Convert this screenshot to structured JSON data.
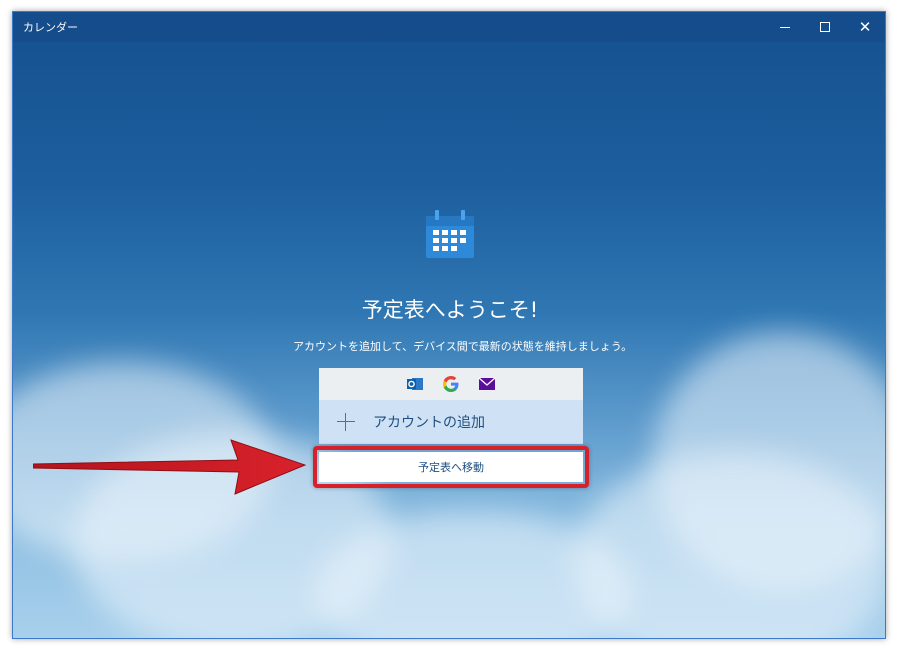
{
  "window": {
    "title": "カレンダー"
  },
  "welcome": {
    "heading": "予定表へようこそ!",
    "description": "アカウントを追加して、デバイス間で最新の状態を維持しましょう。"
  },
  "providers": [
    {
      "icon": "outlook-icon"
    },
    {
      "icon": "google-icon"
    },
    {
      "icon": "yahoo-mail-icon"
    }
  ],
  "actions": {
    "add_account_label": "アカウントの追加",
    "go_to_calendar_label": "予定表へ移動"
  },
  "colors": {
    "accent": "#1f4f80",
    "highlight": "#d6202a",
    "titlebar": "#144c8c"
  }
}
